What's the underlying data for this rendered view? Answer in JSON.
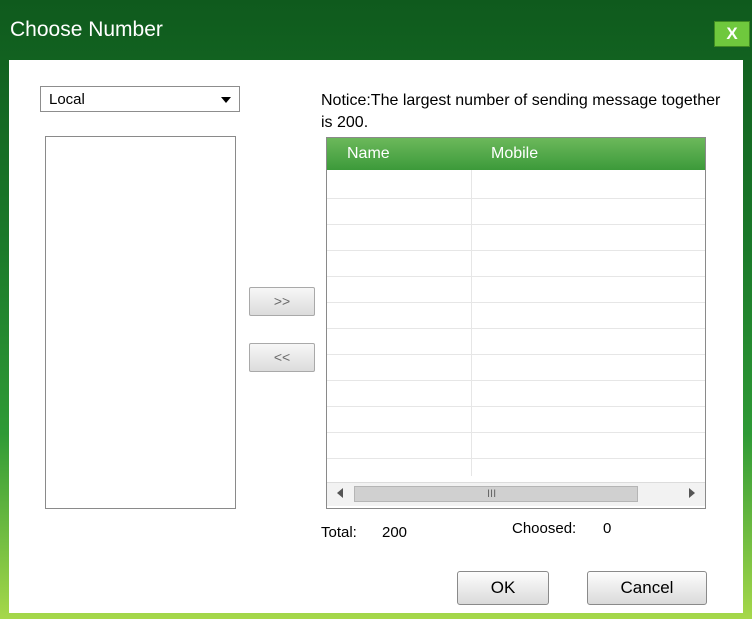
{
  "window": {
    "title": "Choose Number",
    "close_label": "X"
  },
  "source_select": {
    "value": "Local"
  },
  "notice": "Notice:The largest number of sending message together is 200.",
  "transfer": {
    "add_label": ">>",
    "remove_label": "<<"
  },
  "table": {
    "columns": [
      "Name",
      "Mobile"
    ],
    "rows": [],
    "scroll_grip": "III"
  },
  "summary": {
    "total_label": "Total:",
    "total_value": "200",
    "choosed_label": "Choosed:",
    "choosed_value": "0"
  },
  "buttons": {
    "ok_label": "OK",
    "cancel_label": "Cancel"
  }
}
